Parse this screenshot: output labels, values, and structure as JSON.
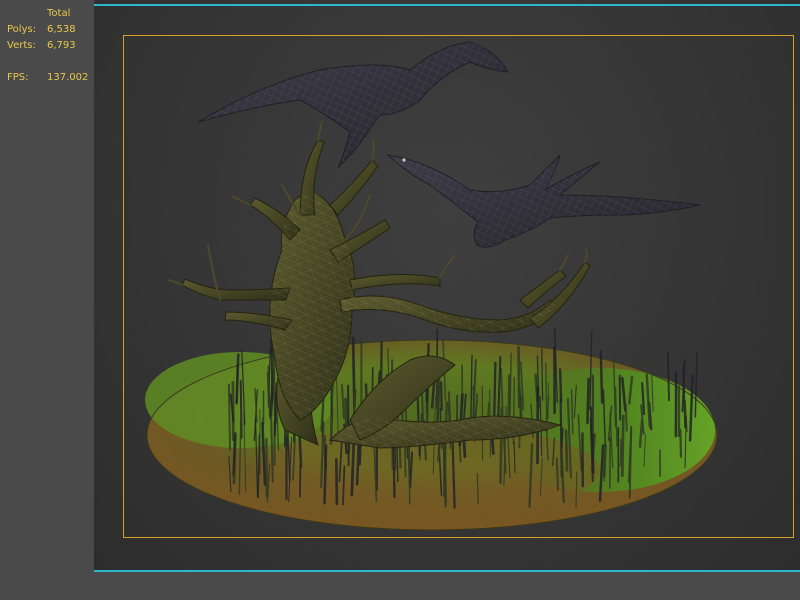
{
  "stats": {
    "header": "Total",
    "rows": [
      {
        "label": "Polys:",
        "value": "6,538"
      },
      {
        "label": "Verts:",
        "value": "6,793"
      }
    ],
    "fps": {
      "label": "FPS:",
      "value": "137.002"
    }
  },
  "colors": {
    "stats_text": "#e8c84a",
    "viewport_border": "#2bb9c9",
    "safe_frame": "#d4a12a"
  },
  "scene": {
    "objects": [
      "crow-flying-left",
      "crow-flying-right",
      "dead-tree",
      "grass-ground-disc"
    ]
  }
}
